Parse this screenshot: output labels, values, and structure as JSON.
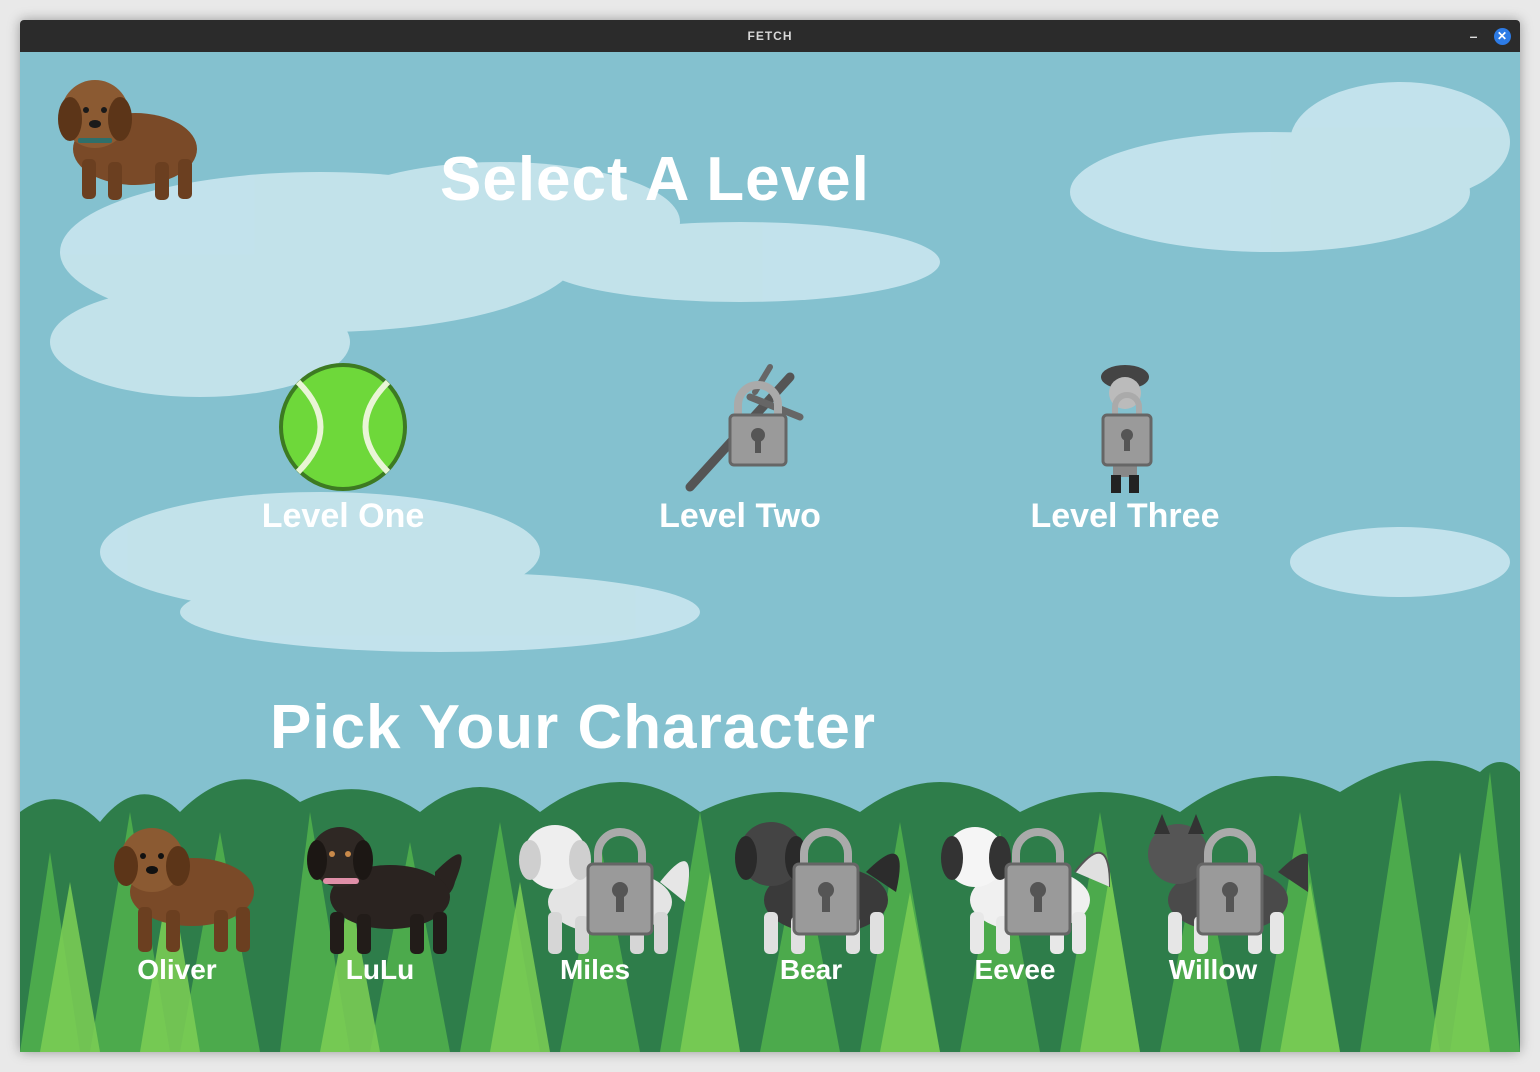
{
  "window": {
    "title": "FETCH"
  },
  "headings": {
    "select_level": "Select A Level",
    "pick_character": "Pick Your Character"
  },
  "levels": [
    {
      "label": "Level One",
      "icon": "tennis-ball-icon",
      "locked": false
    },
    {
      "label": "Level Two",
      "icon": "stick-icon",
      "locked": true
    },
    {
      "label": "Level Three",
      "icon": "person-icon",
      "locked": true
    }
  ],
  "characters": [
    {
      "name": "Oliver",
      "locked": false,
      "color": "#7a4a28"
    },
    {
      "name": "LuLu",
      "locked": false,
      "color": "#2a2320"
    },
    {
      "name": "Miles",
      "locked": true,
      "color": "#e4e4e4"
    },
    {
      "name": "Bear",
      "locked": true,
      "color": "#3a3a3a"
    },
    {
      "name": "Eevee",
      "locked": true,
      "color": "#f0f0f0"
    },
    {
      "name": "Willow",
      "locked": true,
      "color": "#4a4a4a"
    }
  ],
  "colors": {
    "sky": "#84c1cf",
    "grass_dark": "#2e7d4a",
    "grass_light": "#6cc24a",
    "text": "#ffffff",
    "close_button": "#2d7be5"
  }
}
